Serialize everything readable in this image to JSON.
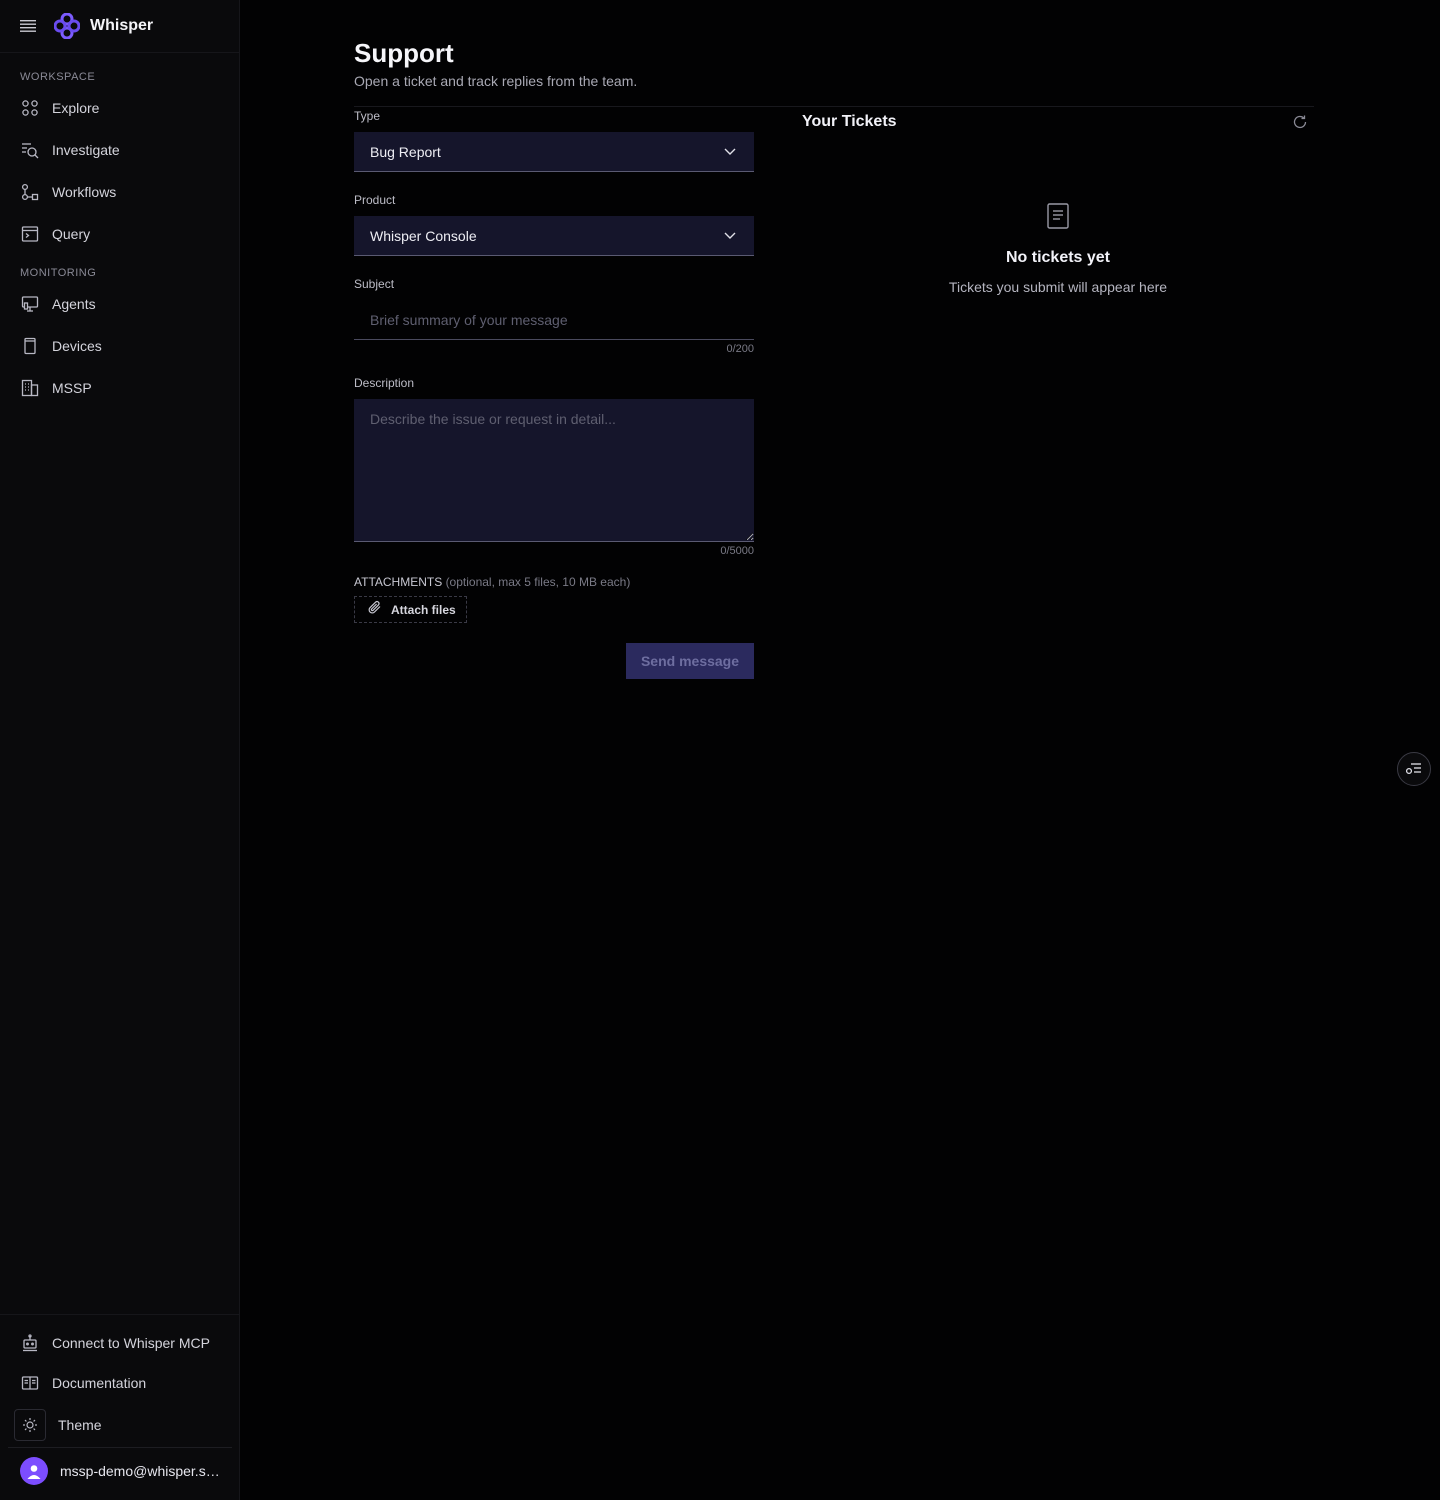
{
  "app": {
    "name": "Whisper"
  },
  "sidebar": {
    "sections": [
      {
        "label": "WORKSPACE"
      },
      {
        "label": "MONITORING"
      }
    ],
    "items": [
      {
        "label": "Explore",
        "icon": "explore-icon"
      },
      {
        "label": "Investigate",
        "icon": "investigate-icon"
      },
      {
        "label": "Workflows",
        "icon": "workflows-icon"
      },
      {
        "label": "Query",
        "icon": "query-icon"
      },
      {
        "label": "Agents",
        "icon": "agents-icon"
      },
      {
        "label": "Devices",
        "icon": "devices-icon"
      },
      {
        "label": "MSSP",
        "icon": "mssp-icon"
      }
    ],
    "bottom": {
      "mcp_label": "Connect to Whisper MCP",
      "docs_label": "Documentation",
      "theme_label": "Theme",
      "user_email": "mssp-demo@whisper.sec..."
    }
  },
  "page": {
    "title": "Support",
    "subtitle": "Open a ticket and track replies from the team."
  },
  "form": {
    "type_label": "Type",
    "type_value": "Bug Report",
    "product_label": "Product",
    "product_value": "Whisper Console",
    "subject_label": "Subject",
    "subject_placeholder": "Brief summary of your message",
    "subject_counter": "0/200",
    "description_label": "Description",
    "description_placeholder": "Describe the issue or request in detail...",
    "description_counter": "0/5000",
    "attachments_label": "ATTACHMENTS",
    "attachments_hint": "(optional, max 5 files, 10 MB each)",
    "attach_button": "Attach files",
    "send_button": "Send message"
  },
  "tickets": {
    "title": "Your Tickets",
    "empty_title": "No tickets yet",
    "empty_subtitle": "Tickets you submit will appear here"
  },
  "colors": {
    "accent": "#7c4dff",
    "background": "#020203",
    "sidebar": "#0a0a0c",
    "input_bg": "#15152b",
    "send_bg": "#2b2a5e"
  }
}
